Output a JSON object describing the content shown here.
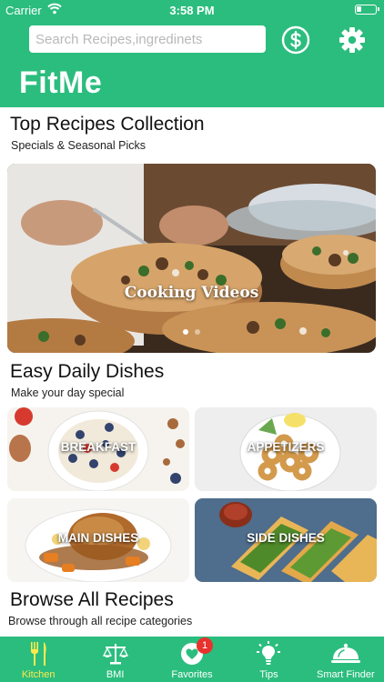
{
  "status_bar": {
    "carrier": "Carrier",
    "time": "3:58 PM"
  },
  "header": {
    "search_placeholder": "Search Recipes,ingredinets",
    "app_title": "FitMe"
  },
  "top_section": {
    "title": "Top Recipes Collection",
    "subtitle": "Specials & Seasonal Picks",
    "hero_label": "Cooking Videos",
    "carousel_pages": 2,
    "carousel_active": 1
  },
  "daily_section": {
    "title": "Easy Daily Dishes",
    "subtitle": "Make your day special",
    "tiles": [
      {
        "label": "BREAKFAST"
      },
      {
        "label": "APPETIZERS"
      },
      {
        "label": "MAIN DISHES"
      },
      {
        "label": "SIDE DISHES"
      }
    ]
  },
  "browse_section": {
    "title": "Browse All Recipes",
    "subtitle": "Browse through all recipe categories"
  },
  "tabbar": {
    "tabs": [
      {
        "label": "Kitchen",
        "icon": "fork-knife-icon",
        "active": true
      },
      {
        "label": "BMI",
        "icon": "scale-icon",
        "active": false
      },
      {
        "label": "Favorites",
        "icon": "heart-icon",
        "active": false,
        "badge": "1"
      },
      {
        "label": "Tips",
        "icon": "lightbulb-icon",
        "active": false
      },
      {
        "label": "Smart Finder",
        "icon": "cloche-icon",
        "active": false
      }
    ]
  },
  "colors": {
    "brand_green": "#2bbd7e",
    "active_tab": "#ffe94d",
    "badge_red": "#e8322e"
  }
}
